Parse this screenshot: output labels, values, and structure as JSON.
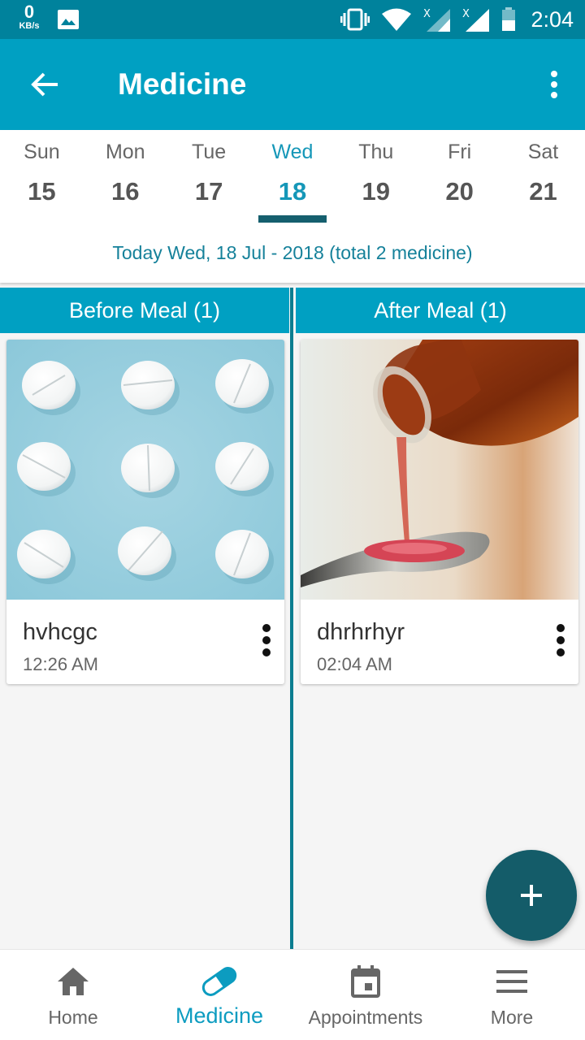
{
  "status_bar": {
    "net_speed": "0",
    "net_unit": "KB/s",
    "time": "2:04"
  },
  "app_bar": {
    "title": "Medicine",
    "back_icon": "arrow-left-icon",
    "menu_icon": "more-vert-icon"
  },
  "week": {
    "days": [
      {
        "name": "Sun",
        "num": "15"
      },
      {
        "name": "Mon",
        "num": "16"
      },
      {
        "name": "Tue",
        "num": "17"
      },
      {
        "name": "Wed",
        "num": "18"
      },
      {
        "name": "Thu",
        "num": "19"
      },
      {
        "name": "Fri",
        "num": "20"
      },
      {
        "name": "Sat",
        "num": "21"
      }
    ],
    "selected_index": 3,
    "today_text": "Today Wed, 18 Jul - 2018 (total 2 medicine)"
  },
  "columns": {
    "before": {
      "header": "Before Meal (1)",
      "card": {
        "name": "hvhcgc",
        "time": "12:26 AM"
      }
    },
    "after": {
      "header": "After Meal (1)",
      "card": {
        "name": "dhrhrhyr",
        "time": "02:04 AM"
      }
    }
  },
  "fab": {
    "icon": "plus-icon"
  },
  "bottom_nav": {
    "items": [
      {
        "label": "Home",
        "icon": "home-icon"
      },
      {
        "label": "Medicine",
        "icon": "pill-icon"
      },
      {
        "label": "Appointments",
        "icon": "calendar-icon"
      },
      {
        "label": "More",
        "icon": "menu-icon"
      }
    ],
    "active_index": 1
  },
  "colors": {
    "status_bar": "#00829c",
    "primary": "#00a0c2",
    "accent_dark": "#145c69",
    "active_text": "#1597b8"
  }
}
